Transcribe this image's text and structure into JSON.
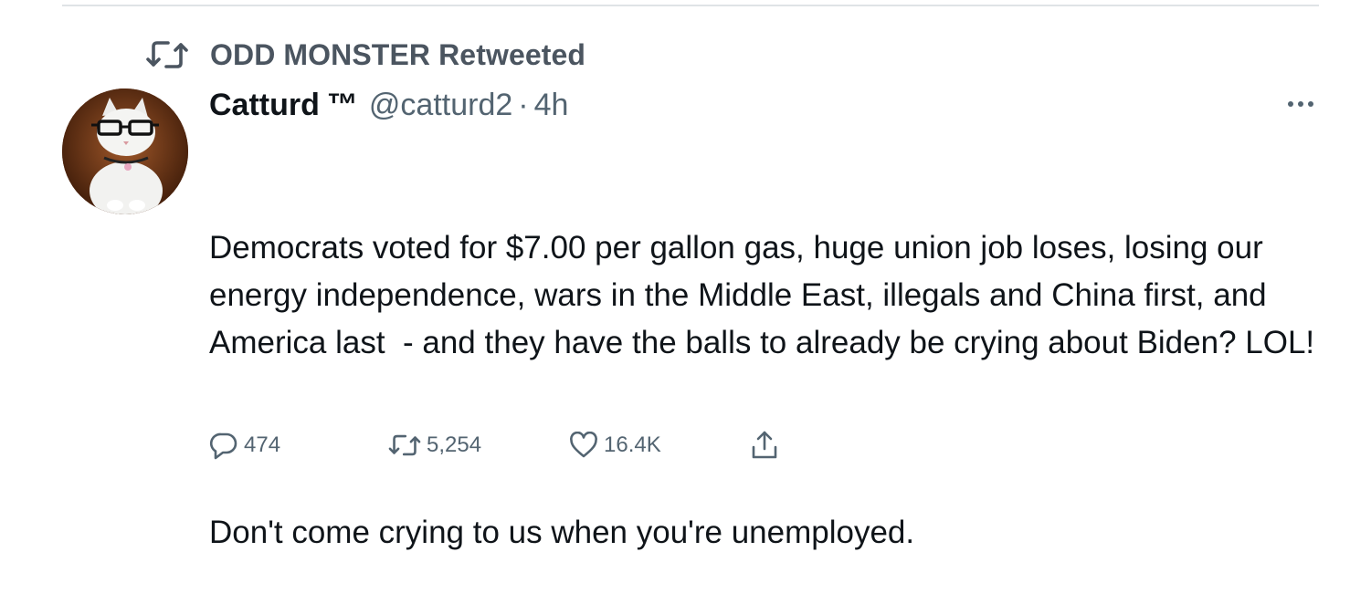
{
  "retweet_context": {
    "label": "ODD MONSTER Retweeted",
    "icon": "retweet-icon"
  },
  "tweet": {
    "author": {
      "display_name": "Catturd",
      "badge": "™",
      "handle": "@catturd2",
      "avatar_icon": "cat-with-glasses-avatar"
    },
    "separator": "·",
    "time": "4h",
    "more_icon": "more-horizontal-icon",
    "text_paragraph_1": "Democrats voted for $7.00 per gallon gas, huge union job loses, losing our energy independence, wars in the Middle East, illegals and China first, and America last  - and they have the balls to already be crying about Biden? LOL!",
    "text_paragraph_2": "Don't come crying to us when you're unemployed.",
    "actions": {
      "reply": {
        "icon": "reply-icon",
        "count": "474"
      },
      "retweet": {
        "icon": "retweet-icon",
        "count": "5,254"
      },
      "like": {
        "icon": "heart-icon",
        "count": "16.4K"
      },
      "share": {
        "icon": "share-icon"
      }
    }
  },
  "colors": {
    "primary_text": "#0f1419",
    "secondary_text": "#536471",
    "context_text": "#4b5560",
    "divider": "#dfe3e6"
  }
}
